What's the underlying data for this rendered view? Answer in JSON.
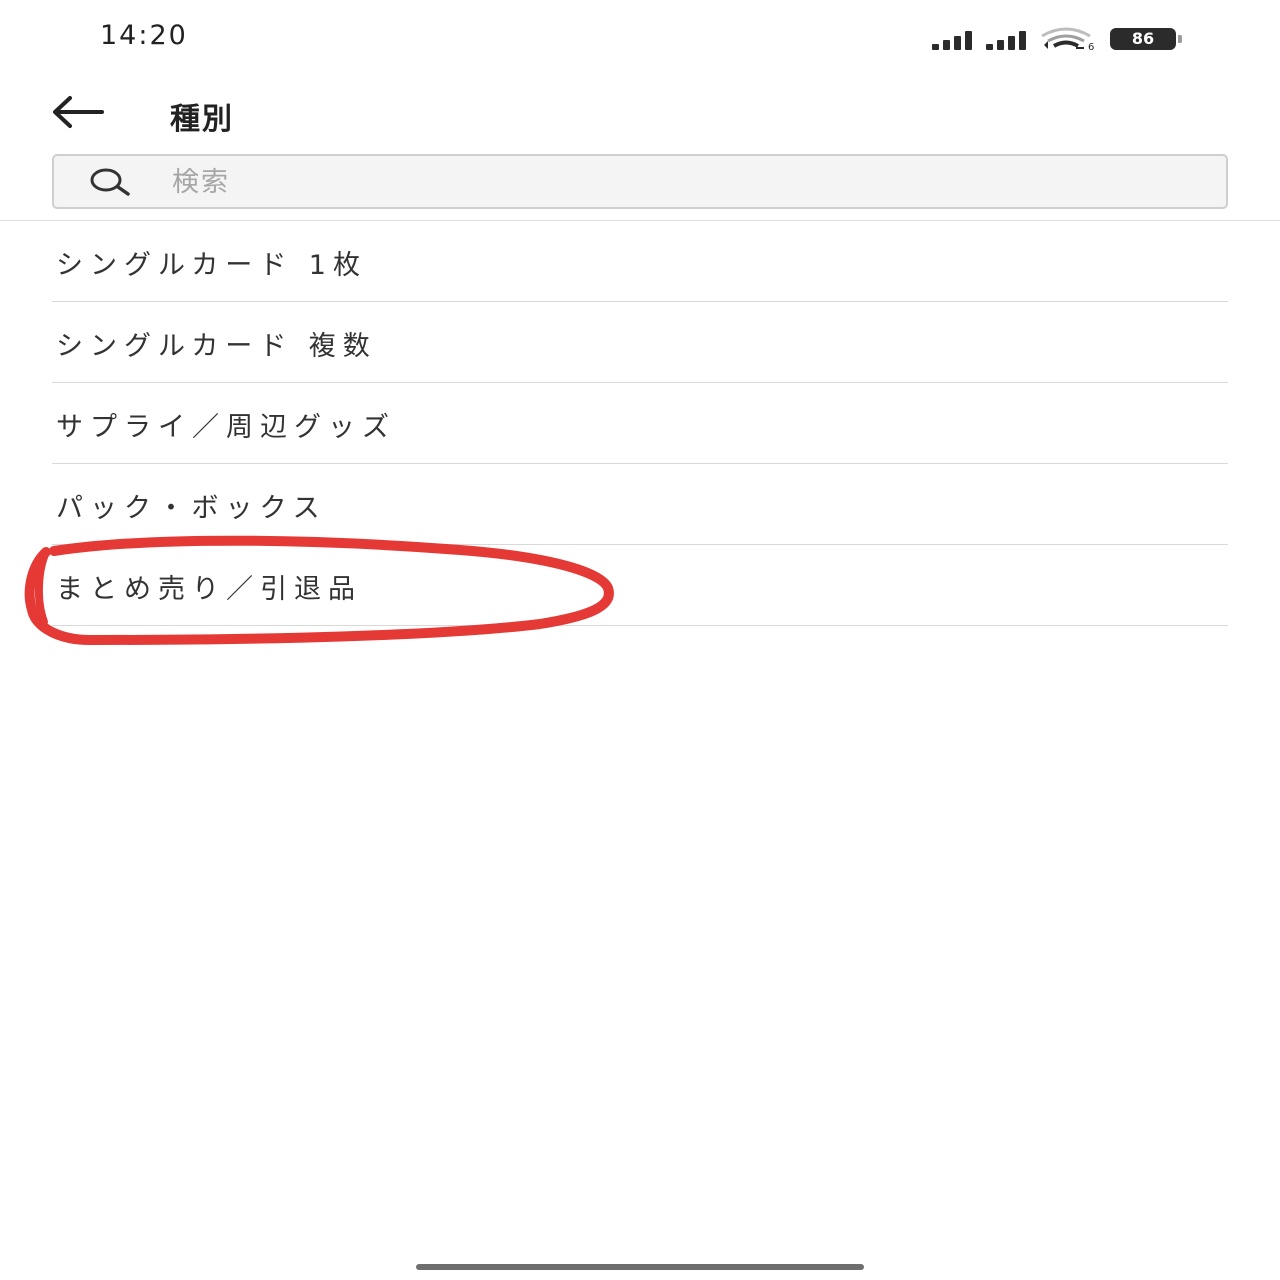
{
  "status_bar": {
    "time": "14:20",
    "wifi_badge": "6",
    "battery": "86"
  },
  "header": {
    "back_icon": "arrow-left-icon",
    "title": "種別"
  },
  "search": {
    "icon": "search-icon",
    "placeholder": "検索",
    "value": ""
  },
  "categories": [
    {
      "label": "シングルカード 1枚"
    },
    {
      "label": "シングルカード 複数"
    },
    {
      "label": "サプライ／周辺グッズ"
    },
    {
      "label": "パック・ボックス"
    },
    {
      "label": "まとめ売り／引退品"
    }
  ],
  "annotation": {
    "type": "hand-drawn circle",
    "color": "#e53935",
    "target": "まとめ売り／引退品"
  },
  "colors": {
    "text": "#333333",
    "divider": "#d9d9d9",
    "search_bg": "#f4f4f4",
    "annotation": "#e53935"
  }
}
